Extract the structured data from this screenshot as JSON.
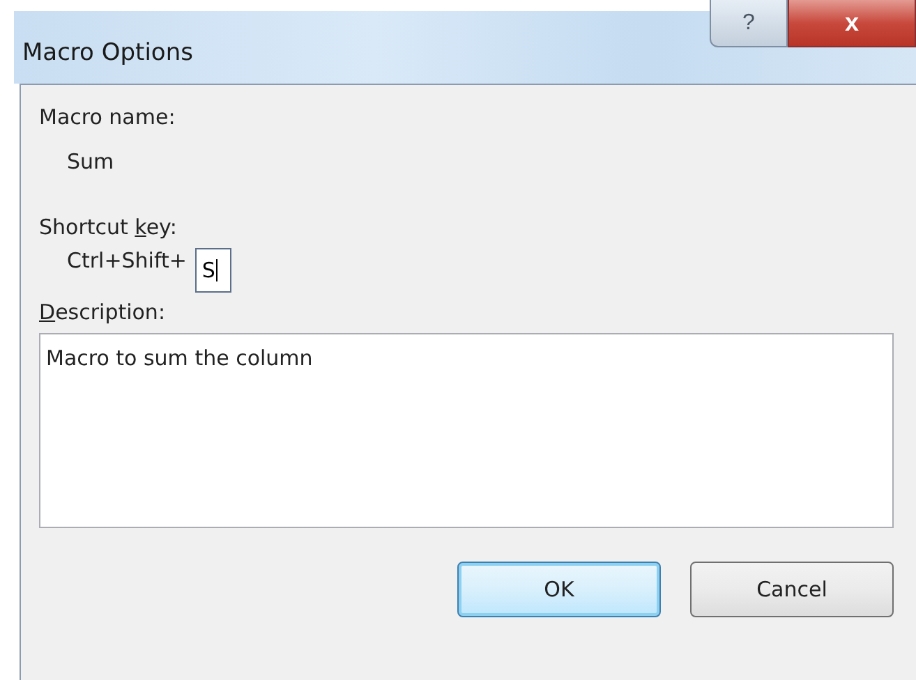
{
  "window": {
    "title": "Macro Options",
    "help_glyph": "?",
    "close_glyph": "x"
  },
  "macro_name": {
    "label": "Macro name:",
    "value": "Sum"
  },
  "shortcut": {
    "label": {
      "before": "Shortcut ",
      "key": "k",
      "after": "ey:"
    },
    "prefix": "Ctrl+Shift+",
    "value": "S",
    "focused": true
  },
  "description": {
    "label": {
      "key": "D",
      "after": "escription:"
    },
    "value": "Macro to sum the column"
  },
  "buttons": [
    {
      "label": "OK",
      "default": true
    },
    {
      "label": "Cancel",
      "default": false
    }
  ]
}
